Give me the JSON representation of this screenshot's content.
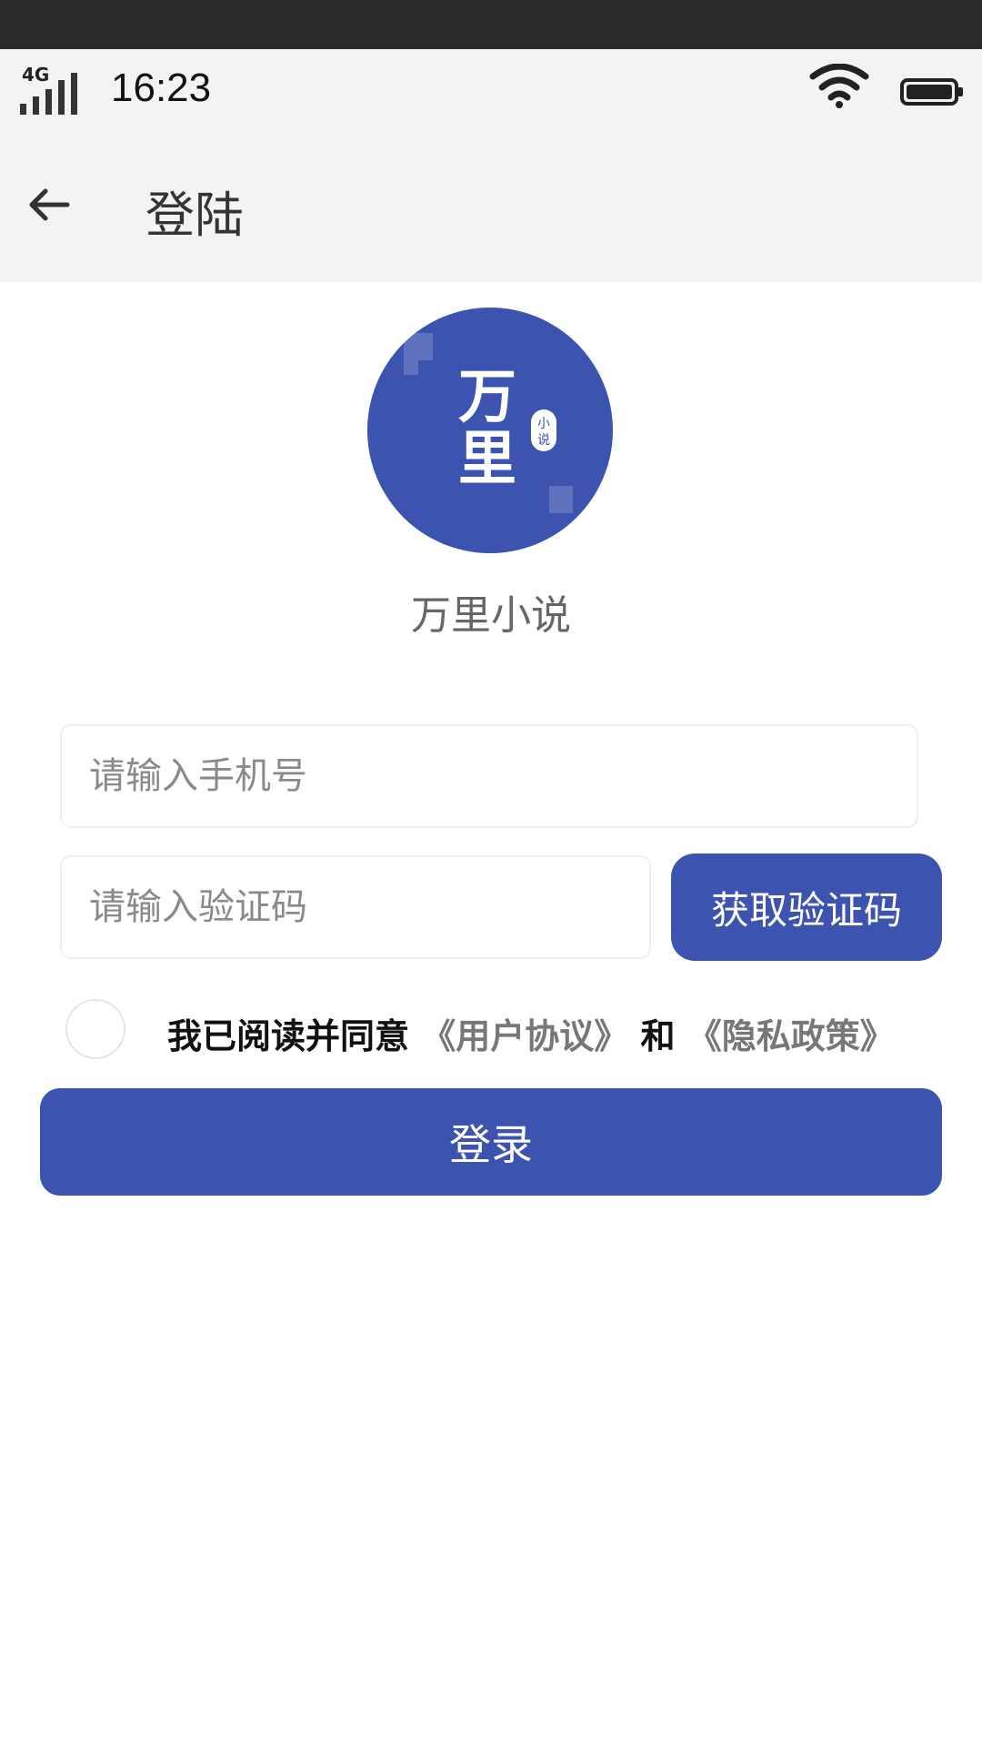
{
  "status_bar": {
    "network": "4G",
    "time": "16:23"
  },
  "app_bar": {
    "title": "登陆"
  },
  "app": {
    "name": "万里小说",
    "logo_text": "万里",
    "logo_badge": "小说",
    "logo_color": "#3c53b0"
  },
  "form": {
    "phone_placeholder": "请输入手机号",
    "code_placeholder": "请输入验证码",
    "get_code_label": "获取验证码",
    "agreement_prefix": "我已阅读并同意",
    "user_agreement": "《用户协议》",
    "agreement_and": "和",
    "privacy_policy": "《隐私政策》",
    "login_label": "登录"
  }
}
